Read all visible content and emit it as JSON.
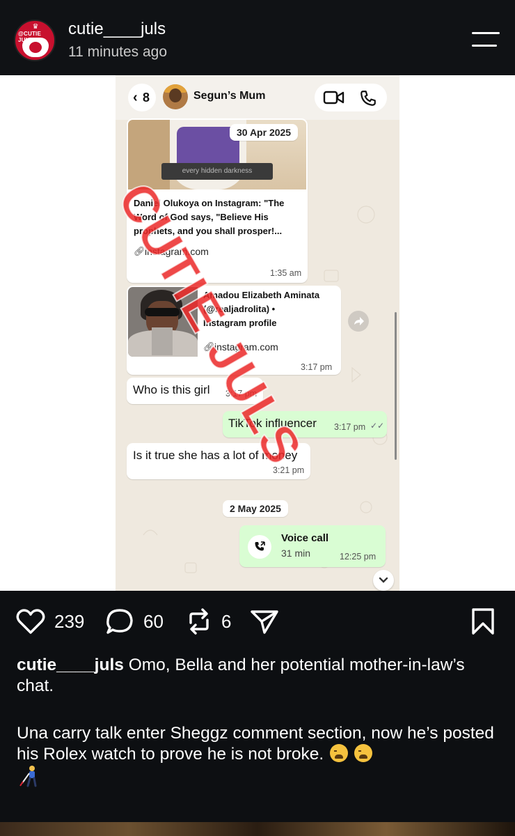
{
  "post_header": {
    "avatar_text": "@CUTIE JULS",
    "username": "cutie____juls",
    "time_ago": "11 minutes ago"
  },
  "chat": {
    "back_count": "8",
    "contact_name": "Segun’s Mum",
    "date_chip_1": "30 Apr 2025",
    "link1": {
      "image_caption": "every hidden darkness",
      "title_lines": [
        "Daniel Olukoya on Instagram: \"The",
        "Word of God says, \"Believe His",
        "prophets, and you shall prosper!..."
      ],
      "url": "instagram.com",
      "time": "1:35 am"
    },
    "link2": {
      "title_lines": [
        "Amadou Elizabeth Aminata",
        "(@realjadrolita) •",
        "Instagram profile"
      ],
      "url": "instagram.com",
      "time": "3:17 pm"
    },
    "messages": [
      {
        "text": "Who is this girl",
        "time": "3:17 pm",
        "direction": "in"
      },
      {
        "text": "TikTok influencer",
        "time": "3:17 pm",
        "direction": "out"
      },
      {
        "text": "Is it true she has a lot of money",
        "time": "3:21 pm",
        "direction": "in"
      }
    ],
    "date_chip_2": "2 May 2025",
    "voice_call": {
      "label": "Voice call",
      "duration": "31 min",
      "time": "12:25 pm"
    },
    "watermark": "CUTIE JULS"
  },
  "actions": {
    "likes": "239",
    "comments": "60",
    "reposts": "6"
  },
  "caption": {
    "username": "cutie____juls",
    "text": " Omo, Bella and her potential mother-in-law’s chat.",
    "paragraph2": "Una carry talk enter Sheggz comment section, now he’s posted his Rolex watch to prove he is not broke. "
  },
  "colors": {
    "background": "#0d0f12",
    "outgoing_bubble": "#d9fdd3",
    "chat_bg": "#efe9df",
    "watermark": "#eb2828"
  }
}
